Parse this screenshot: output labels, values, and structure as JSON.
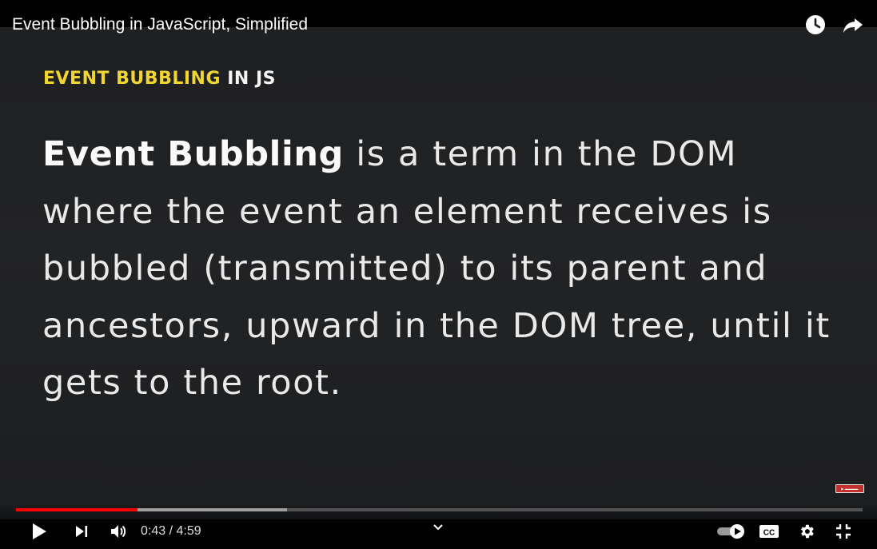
{
  "video": {
    "title": "Event Bubbling in JavaScript, Simplified"
  },
  "slide": {
    "heading_highlight": "EVENT BUBBLING",
    "heading_rest": "IN JS",
    "body_strong": "Event Bubbling",
    "body_text": " is a term in the DOM where the event an element receives is bubbled (transmitted) to its parent and ancestors, upward in the DOM tree, until it gets to the root."
  },
  "player": {
    "current_time": "0:43",
    "duration": "4:59",
    "time_display": "0:43 / 4:59",
    "progress_fraction": 0.144,
    "buffered_fraction": 0.32,
    "autoplay_on": true
  },
  "icons": {
    "watch_later": "clock-icon",
    "share": "share-arrow-icon",
    "play": "play-icon",
    "next": "skip-next-icon",
    "volume": "volume-icon",
    "chapters": "chevron-down-icon",
    "autoplay": "autoplay-toggle-icon",
    "captions": "closed-captions-icon",
    "settings": "gear-icon",
    "exit_fullscreen": "exit-fullscreen-icon"
  },
  "colors": {
    "accent_yellow": "#f1d62f",
    "progress_red": "#ff0000",
    "slide_background": "#212224"
  }
}
